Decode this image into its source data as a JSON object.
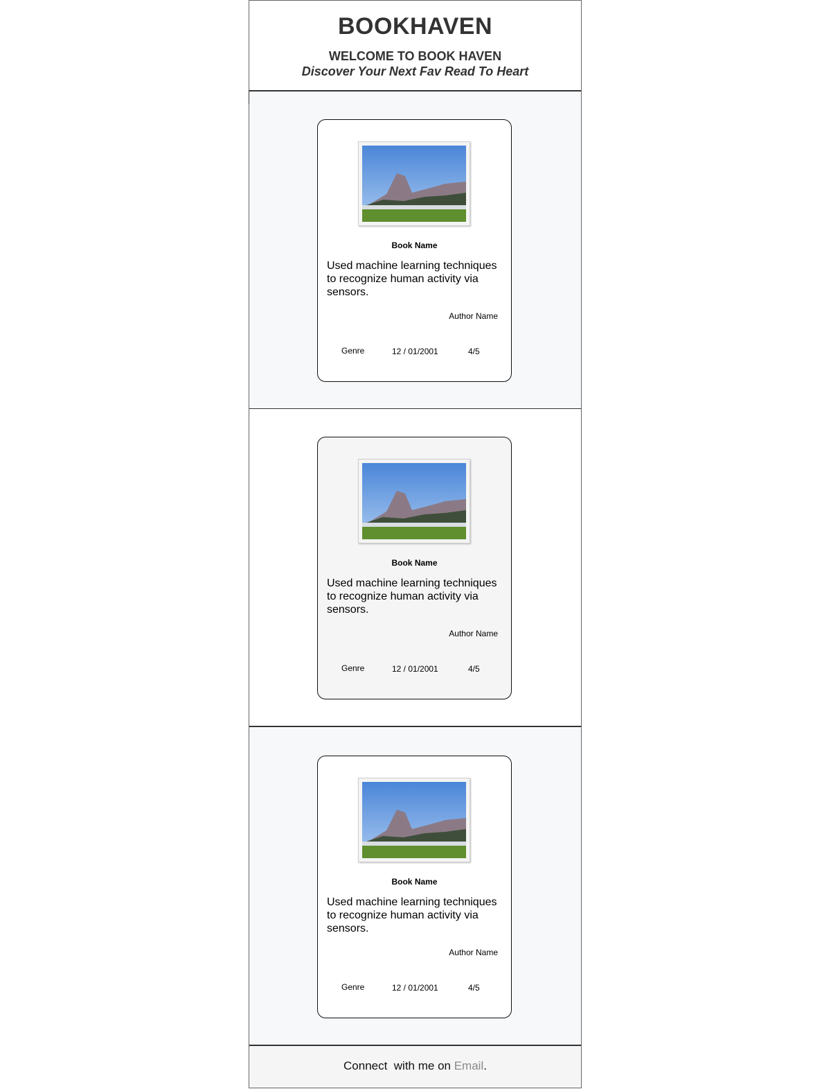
{
  "header": {
    "brand": "BOOKHAVEN",
    "welcome": "WELCOME TO BOOK HAVEN",
    "tagline": "Discover Your Next Fav Read To Heart"
  },
  "books": [
    {
      "image_icon": "book-cover-photo",
      "name": "Book Name",
      "description": "Used machine learning techniques to recognize human activity via sensors.",
      "author": "Author Name",
      "genre": "Genre",
      "date": "12 / 01/2001",
      "rating": "4/5"
    },
    {
      "image_icon": "book-cover-photo",
      "name": "Book Name",
      "description": "Used machine learning techniques to recognize human activity via sensors.",
      "author": "Author Name",
      "genre": "Genre",
      "date": "12 / 01/2001",
      "rating": "4/5"
    },
    {
      "image_icon": "book-cover-photo",
      "name": "Book Name",
      "description": "Used machine learning techniques to recognize human activity via sensors.",
      "author": "Author Name",
      "genre": "Genre",
      "date": "12 / 01/2001",
      "rating": "4/5"
    }
  ],
  "footer": {
    "prefix": "Connect  with me on ",
    "link_label": "Email",
    "suffix": "."
  },
  "colors": {
    "heading_text": "#333333",
    "section_alt_bg": "#f7f8fa",
    "card_grey_bg": "#f5f5f5",
    "footer_bg": "#f5f5f5",
    "link": "#8a8a8a"
  }
}
